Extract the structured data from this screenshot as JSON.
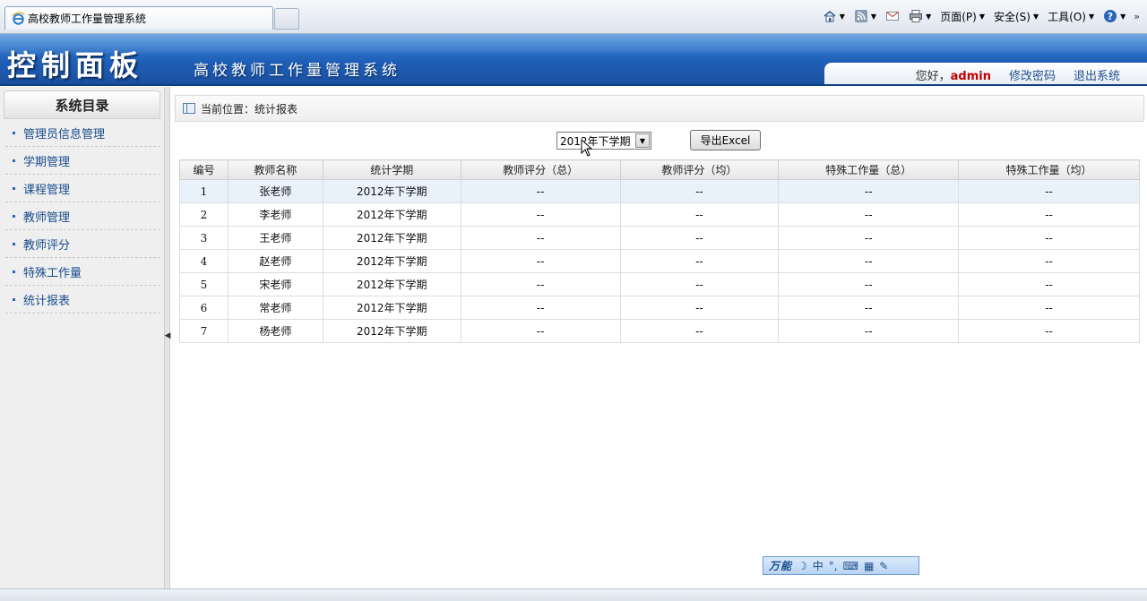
{
  "browser": {
    "tab_title": "高校教师工作量管理系统",
    "menus": [
      {
        "label": "页面(P)"
      },
      {
        "label": "安全(S)"
      },
      {
        "label": "工具(O)"
      }
    ]
  },
  "header": {
    "panel_title": "控制面板",
    "system_title": "高校教师工作量管理系统",
    "greeting": "您好，",
    "username": "admin",
    "change_password": "修改密码",
    "logout": "退出系统"
  },
  "sidebar": {
    "title": "系统目录",
    "items": [
      {
        "label": "管理员信息管理"
      },
      {
        "label": "学期管理"
      },
      {
        "label": "课程管理"
      },
      {
        "label": "教师管理"
      },
      {
        "label": "教师评分"
      },
      {
        "label": "特殊工作量"
      },
      {
        "label": "统计报表"
      }
    ]
  },
  "main": {
    "breadcrumb": "当前位置：统计报表",
    "term_select": "2012年下学期",
    "export_label": "导出Excel",
    "columns": [
      "编号",
      "教师名称",
      "统计学期",
      "教师评分（总）",
      "教师评分（均）",
      "特殊工作量（总）",
      "特殊工作量（均）"
    ],
    "rows": [
      [
        "1",
        "张老师",
        "2012年下学期",
        "--",
        "--",
        "--",
        "--"
      ],
      [
        "2",
        "李老师",
        "2012年下学期",
        "--",
        "--",
        "--",
        "--"
      ],
      [
        "3",
        "王老师",
        "2012年下学期",
        "--",
        "--",
        "--",
        "--"
      ],
      [
        "4",
        "赵老师",
        "2012年下学期",
        "--",
        "--",
        "--",
        "--"
      ],
      [
        "5",
        "宋老师",
        "2012年下学期",
        "--",
        "--",
        "--",
        "--"
      ],
      [
        "6",
        "常老师",
        "2012年下学期",
        "--",
        "--",
        "--",
        "--"
      ],
      [
        "7",
        "杨老师",
        "2012年下学期",
        "--",
        "--",
        "--",
        "--"
      ]
    ]
  },
  "ime": {
    "brand": "万能",
    "mode": "中"
  },
  "colors": {
    "header_blue": "#1f5fb8",
    "link_blue": "#1a4d8c",
    "admin_red": "#c00000"
  }
}
